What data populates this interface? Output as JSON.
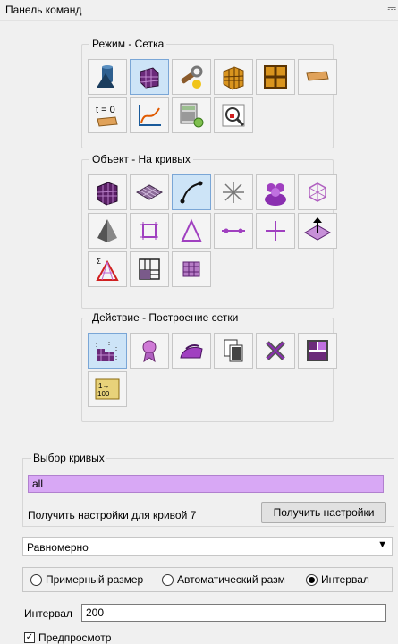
{
  "panel": {
    "title": "Панель команд"
  },
  "mode_group": {
    "label": "Режим - Сетка"
  },
  "object_group": {
    "label": "Объект - На кривых"
  },
  "action_group": {
    "label": "Действие - Построение сетки"
  },
  "mode_icons": [
    "geometry-icon",
    "mesh-icon",
    "tools-icon",
    "volume-mesh-icon",
    "grid-icon",
    "boundary-condition-icon",
    "time-zero-icon",
    "plot-icon",
    "calculator-icon",
    "zoom-icon"
  ],
  "object_icons": [
    "volume-icon",
    "surface-icon",
    "curve-icon",
    "vertex-star-icon",
    "group-icon",
    "node-icon",
    "pyramid-icon",
    "quad-element-icon",
    "triangle-element-icon",
    "edge-element-icon",
    "node-element-icon",
    "normal-icon",
    "sideset-icon",
    "mesh-block-icon",
    "grid-table-icon"
  ],
  "action_icons": [
    "mesh-curve-icon",
    "award-icon",
    "iron-icon",
    "copy-mesh-icon",
    "delete-mesh-icon",
    "layout-icon",
    "interval-icon"
  ],
  "interval_icon_text": "1→\n100",
  "time_icon_text": "t = 0",
  "curve_selection": {
    "label": "Выбор кривых",
    "value": "all",
    "get_text": "Получить настройки для кривой 7",
    "get_button": "Получить настройки"
  },
  "scheme": {
    "value": "Равномерно"
  },
  "radios": [
    {
      "label": "Примерный размер",
      "checked": false
    },
    {
      "label": "Автоматический разм",
      "checked": false
    },
    {
      "label": "Интервал",
      "checked": true
    }
  ],
  "interval": {
    "label": "Интервал",
    "value": "200"
  },
  "preview": {
    "label": "Предпросмотр",
    "checked": true
  },
  "colors": {
    "accent": "#cde4f7",
    "selection_field": "#d8a8f5"
  }
}
